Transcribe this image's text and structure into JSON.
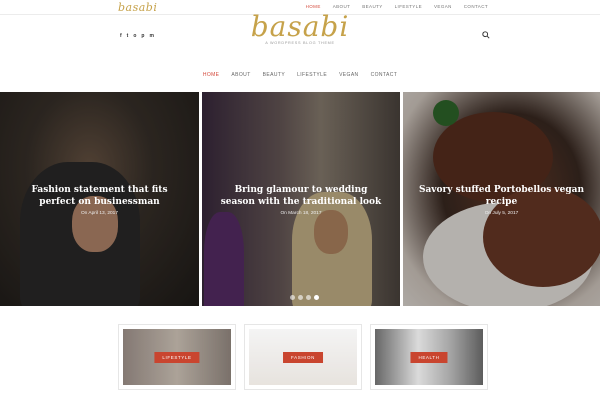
{
  "topbar": {
    "logo": "basabi",
    "nav": [
      "HOME",
      "ABOUT",
      "BEAUTY",
      "LIFESTYLE",
      "VEGAN",
      "CONTACT"
    ]
  },
  "header": {
    "logo": "basabi",
    "tagline": "A WORDPRESS BLOG THEME",
    "social": [
      "f",
      "t",
      "o",
      "p",
      "m"
    ]
  },
  "mainnav": {
    "items": [
      "HOME",
      "ABOUT",
      "BEAUTY",
      "LIFESTYLE",
      "VEGAN",
      "CONTACT"
    ]
  },
  "slides": [
    {
      "title": "Fashion statement that fits perfect on businessman",
      "date": "On April 13, 2017"
    },
    {
      "title": "Bring glamour to wedding season with the traditional look",
      "date": "On March 18, 2017"
    },
    {
      "title": "Savory stuffed Portobellos vegan recipe",
      "date": "On July 5, 2017"
    }
  ],
  "categories": [
    "LIFESTYLE",
    "FASHION",
    "HEALTH"
  ],
  "colors": {
    "accent": "#d4493b",
    "gold": "#c6a24a",
    "badge": "#c9452f"
  }
}
